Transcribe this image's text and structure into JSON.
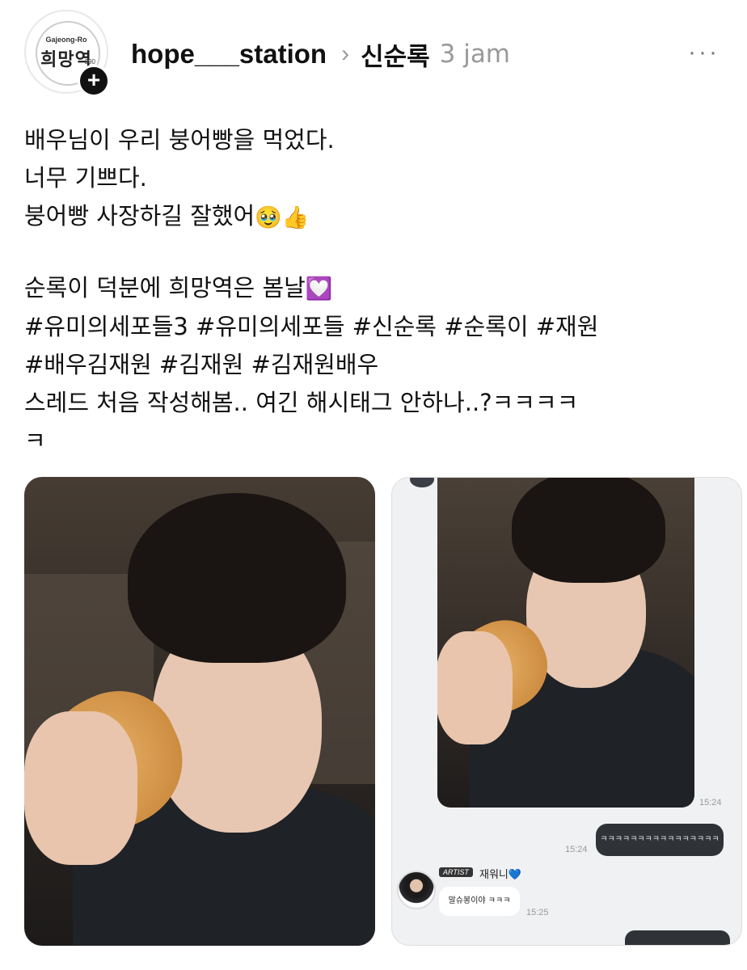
{
  "header": {
    "avatar": {
      "top_text": "Gajeong-Ro",
      "main_text": "희망역",
      "number": "390"
    },
    "add_icon": "plus-icon",
    "username": "hope___station",
    "separator": "›",
    "reply_to": "신순록",
    "time": "3 jam",
    "more_icon": "···"
  },
  "post": {
    "lines": [
      "배우님이 우리 붕어빵을 먹었다.",
      "너무 기쁘다.",
      "붕어빵 사장하길 잘했어"
    ],
    "emoji_line3": "🥹👍",
    "line4": "순록이 덕분에 희망역은 봄날",
    "emoji_line4": "💟",
    "hashtags1": "#유미의세포들3 #유미의세포들 #신순록 #순록이 #재원",
    "hashtags2": "#배우김재원 #김재원 #김재원배우",
    "line7": "스레드 처음 작성해봄.. 여긴 해시태그 안하나..?ㅋㅋㅋㅋ",
    "line8": "ㅋ"
  },
  "chat": {
    "time1": "15:24",
    "time2": "15:24",
    "sent_message": "ㅋㅋㅋㅋㅋㅋㅋㅋㅋㅋㅋㅋㅋㅋㅋㅋ",
    "artist_badge": "ARTIST",
    "artist_name": "재워니💙",
    "artist_message": "말슈봉이야 ㅋㅋㅋ",
    "time3": "15:25"
  }
}
